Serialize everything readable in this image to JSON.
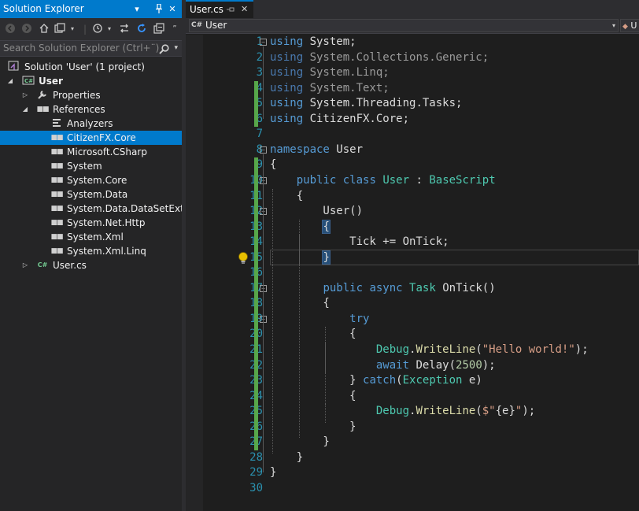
{
  "solution_explorer": {
    "title": "Solution Explorer",
    "search_placeholder": "Search Solution Explorer (Ctrl+¨)",
    "tree": [
      {
        "label": "Solution 'User' (1 project)",
        "indent": 0,
        "icon": "solution-icon",
        "arrow": ""
      },
      {
        "label": "User",
        "indent": 1,
        "icon": "csharp-project-icon",
        "arrow": "expanded",
        "bold": true
      },
      {
        "label": "Properties",
        "indent": 2,
        "icon": "wrench-icon",
        "arrow": "collapsed"
      },
      {
        "label": "References",
        "indent": 2,
        "icon": "references-icon",
        "arrow": "expanded"
      },
      {
        "label": "Analyzers",
        "indent": 3,
        "icon": "analyzers-icon",
        "arrow": ""
      },
      {
        "label": "CitizenFX.Core",
        "indent": 3,
        "icon": "reference-icon",
        "arrow": "",
        "selected": true
      },
      {
        "label": "Microsoft.CSharp",
        "indent": 3,
        "icon": "reference-icon",
        "arrow": ""
      },
      {
        "label": "System",
        "indent": 3,
        "icon": "reference-icon",
        "arrow": ""
      },
      {
        "label": "System.Core",
        "indent": 3,
        "icon": "reference-icon",
        "arrow": ""
      },
      {
        "label": "System.Data",
        "indent": 3,
        "icon": "reference-icon",
        "arrow": ""
      },
      {
        "label": "System.Data.DataSetExtensi",
        "indent": 3,
        "icon": "reference-icon",
        "arrow": ""
      },
      {
        "label": "System.Net.Http",
        "indent": 3,
        "icon": "reference-icon",
        "arrow": ""
      },
      {
        "label": "System.Xml",
        "indent": 3,
        "icon": "reference-icon",
        "arrow": ""
      },
      {
        "label": "System.Xml.Linq",
        "indent": 3,
        "icon": "reference-icon",
        "arrow": ""
      },
      {
        "label": "User.cs",
        "indent": 2,
        "icon": "csharp-file-icon",
        "arrow": "collapsed"
      }
    ]
  },
  "editor": {
    "tab_label": "User.cs",
    "nav_left": "User",
    "nav_right": "U",
    "csharp_badge": "C#",
    "lines": [
      {
        "n": "1",
        "code": [
          [
            "k",
            "using"
          ],
          [
            "",
            "System;"
          ]
        ]
      },
      {
        "n": "2",
        "code": [
          [
            "k",
            "using"
          ],
          [
            "",
            "System.Collections.Generic;"
          ]
        ],
        "dim": true
      },
      {
        "n": "3",
        "code": [
          [
            "k",
            "using"
          ],
          [
            "",
            "System.Linq;"
          ]
        ],
        "dim": true
      },
      {
        "n": "4",
        "code": [
          [
            "k",
            "using"
          ],
          [
            "",
            "System.Text;"
          ]
        ],
        "dim": true
      },
      {
        "n": "5",
        "code": [
          [
            "k",
            "using"
          ],
          [
            "",
            "System.Threading.Tasks;"
          ]
        ]
      },
      {
        "n": "6",
        "code": [
          [
            "k",
            "using"
          ],
          [
            "",
            "CitizenFX.Core;"
          ]
        ]
      },
      {
        "n": "7",
        "code": []
      },
      {
        "n": "8",
        "code": [
          [
            "k",
            "namespace"
          ],
          [
            "",
            " User"
          ]
        ]
      },
      {
        "n": "9",
        "code": [
          [
            "",
            "{"
          ]
        ]
      },
      {
        "n": "10",
        "code": [
          [
            "",
            "    "
          ],
          [
            "k",
            "public"
          ],
          [
            "",
            " "
          ],
          [
            "k",
            "class"
          ],
          [
            "",
            " "
          ],
          [
            "t",
            "User"
          ],
          [
            "",
            " : "
          ],
          [
            "t",
            "BaseScript"
          ]
        ]
      },
      {
        "n": "11",
        "code": [
          [
            "",
            "    {"
          ]
        ]
      },
      {
        "n": "12",
        "code": [
          [
            "",
            "        User()"
          ]
        ]
      },
      {
        "n": "13",
        "code": [
          [
            "",
            "        "
          ],
          [
            "b",
            "{"
          ]
        ]
      },
      {
        "n": "14",
        "code": [
          [
            "",
            "            Tick += OnTick;"
          ]
        ]
      },
      {
        "n": "15",
        "code": [
          [
            "",
            "        "
          ],
          [
            "b",
            "}"
          ]
        ]
      },
      {
        "n": "16",
        "code": []
      },
      {
        "n": "17",
        "code": [
          [
            "",
            "        "
          ],
          [
            "k",
            "public"
          ],
          [
            "",
            " "
          ],
          [
            "k",
            "async"
          ],
          [
            "",
            " "
          ],
          [
            "t",
            "Task"
          ],
          [
            "",
            " OnTick()"
          ]
        ]
      },
      {
        "n": "18",
        "code": [
          [
            "",
            "        {"
          ]
        ]
      },
      {
        "n": "19",
        "code": [
          [
            "",
            "            "
          ],
          [
            "k",
            "try"
          ]
        ]
      },
      {
        "n": "20",
        "code": [
          [
            "",
            "            {"
          ]
        ]
      },
      {
        "n": "21",
        "code": [
          [
            "",
            "                "
          ],
          [
            "t",
            "Debug"
          ],
          [
            "",
            "."
          ],
          [
            "m",
            "WriteLine"
          ],
          [
            "",
            "("
          ],
          [
            "s",
            "\"Hello world!\""
          ],
          [
            "",
            ");"
          ]
        ]
      },
      {
        "n": "22",
        "code": [
          [
            "",
            "                "
          ],
          [
            "k",
            "await"
          ],
          [
            "",
            " Delay("
          ],
          [
            "n",
            "2500"
          ],
          [
            "",
            ");"
          ]
        ]
      },
      {
        "n": "23",
        "code": [
          [
            "",
            "            } "
          ],
          [
            "k",
            "catch"
          ],
          [
            "",
            "("
          ],
          [
            "t",
            "Exception"
          ],
          [
            "",
            " e)"
          ]
        ]
      },
      {
        "n": "24",
        "code": [
          [
            "",
            "            {"
          ]
        ]
      },
      {
        "n": "25",
        "code": [
          [
            "",
            "                "
          ],
          [
            "t",
            "Debug"
          ],
          [
            "",
            "."
          ],
          [
            "m",
            "WriteLine"
          ],
          [
            "",
            "("
          ],
          [
            "s",
            "$\""
          ],
          [
            "",
            "{e}"
          ],
          [
            "s",
            "\""
          ],
          [
            "",
            ");"
          ]
        ]
      },
      {
        "n": "26",
        "code": [
          [
            "",
            "            }"
          ]
        ]
      },
      {
        "n": "27",
        "code": [
          [
            "",
            "        }"
          ]
        ]
      },
      {
        "n": "28",
        "code": [
          [
            "",
            "    }"
          ]
        ]
      },
      {
        "n": "29",
        "code": [
          [
            "",
            "}"
          ]
        ]
      },
      {
        "n": "30",
        "code": []
      }
    ]
  }
}
